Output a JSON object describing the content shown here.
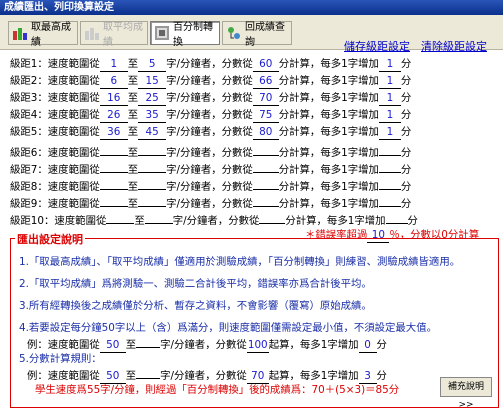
{
  "window_title": "成績匯出、列印換算設定",
  "toolbar": {
    "buttons": [
      {
        "label": "取最高成績",
        "icon": "best-score-icon"
      },
      {
        "label": "取平均成績",
        "icon": "average-score-icon"
      },
      {
        "label": "百分制轉換",
        "icon": "percent-convert-icon"
      },
      {
        "label": "回成績查詢",
        "icon": "back-to-query-icon"
      }
    ]
  },
  "links": {
    "save": "儲存級距設定",
    "clear": "清除級距設定"
  },
  "levels": [
    {
      "label": "級距1：速度範圍從",
      "from": "1",
      "to": "5",
      "score": "60",
      "inc": "1"
    },
    {
      "label": "級距2：速度範圍從",
      "from": "6",
      "to": "15",
      "score": "66",
      "inc": "1"
    },
    {
      "label": "級距3：速度範圍從",
      "from": "16",
      "to": "25",
      "score": "70",
      "inc": "1"
    },
    {
      "label": "級距4：速度範圍從",
      "from": "26",
      "to": "35",
      "score": "75",
      "inc": "1"
    },
    {
      "label": "級距5：速度範圍從",
      "from": "36",
      "to": "45",
      "score": "80",
      "inc": "1"
    },
    {
      "label": "級距6：速度範圍從",
      "from": "",
      "to": "",
      "score": "",
      "inc": ""
    },
    {
      "label": "級距7：速度範圍從",
      "from": "",
      "to": "",
      "score": "",
      "inc": ""
    },
    {
      "label": "級距8：速度範圍從",
      "from": "",
      "to": "",
      "score": "",
      "inc": ""
    },
    {
      "label": "級距9：速度範圍從",
      "from": "",
      "to": "",
      "score": "",
      "inc": ""
    },
    {
      "label": "級距10：速度範圍從",
      "from": "",
      "to": "",
      "score": "",
      "inc": ""
    }
  ],
  "row_text": {
    "to": "至",
    "unit": "字/分鐘者，分數從",
    "score_calc": "分計算，每多1字增加",
    "points": "分"
  },
  "error_note": {
    "prefix": "＊錯誤率超過",
    "value": "10",
    "suffix": "％，分數以0分計算"
  },
  "explain": {
    "title": "匯出設定說明",
    "l1": "1.「取最高成績」、「取平均成績」僅適用於測驗成績，「百分制轉換」則練習、測驗成績皆適用。",
    "l2": "2.「取平均成績」爲將測驗一、測驗二合計後平均，錯誤率亦爲合計後平均。",
    "l3": "3.所有經轉換後之成績僅於分析、暫存之資料，不會影響（覆寫）原始成績。",
    "l4": "4.若要設定每分鐘50字以上（含）爲滿分，則速度範圍僅需設定最小值，不須設定最大值。",
    "ex1": {
      "pre": "例：速度範圍從",
      "from": "50",
      "mid": "至",
      "unit": "字/分鐘者，分數從",
      "score": "100",
      "tail": "起算，每多1字增加",
      "inc": "0",
      "end": "分"
    },
    "l5": "5.分數計算規則：",
    "ex2": {
      "pre": "例：速度範圍從",
      "from": "50",
      "mid": "至",
      "unit": "字/分鐘者，分數從",
      "score": "70",
      "tail": "起算，每多1字增加",
      "inc": "3",
      "end": "分"
    },
    "l6": "學生速度爲55字/分鐘，則經過「百分制轉換」後的成績爲：70＋(5×3)＝85分",
    "more_button": "補充說明>>"
  }
}
